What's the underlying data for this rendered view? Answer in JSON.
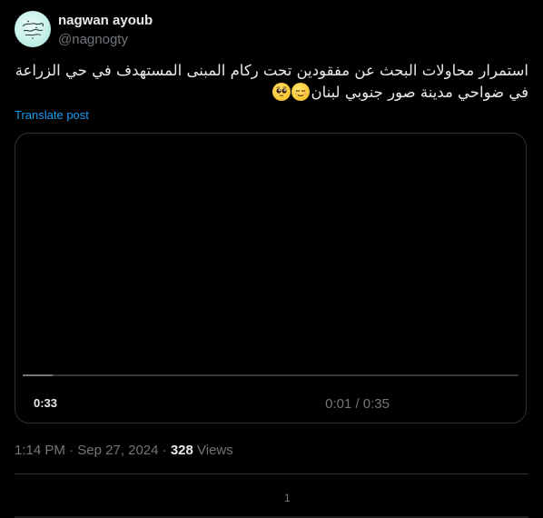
{
  "author": {
    "display_name": "nagwan ayoub",
    "handle": "@nagnogty",
    "avatar_icon": "avatar-calligraphy-icon"
  },
  "tweet": {
    "text": "استمرار محاولات البحث عن مفقودين تحت ركام المبنى المستهدف في حي الزراعة في ضواحي مدينة صور جنوبي لبنان",
    "emojis": [
      "relieved-face-icon",
      "pleading-face-icon"
    ],
    "translate_label": "Translate post"
  },
  "video": {
    "remaining_time": "0:33",
    "time_display": "0:01 / 0:35",
    "progress_fraction": 0.06
  },
  "meta": {
    "time": "1:14 PM",
    "separator": "·",
    "date": "Sep 27, 2024",
    "views_count": "328",
    "views_label": "Views"
  },
  "replies": {
    "count": "1"
  },
  "colors": {
    "background": "#000000",
    "text_primary": "#e7e9ea",
    "text_secondary": "#71767b",
    "link": "#1d9bf0",
    "border": "#2f3336"
  }
}
